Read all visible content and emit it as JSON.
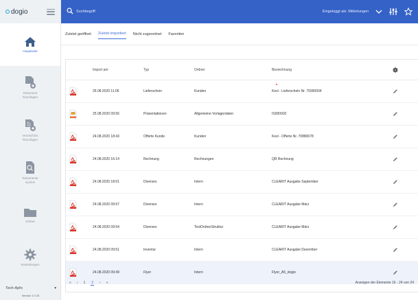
{
  "app": {
    "logo_text": "dogio"
  },
  "sidebar": {
    "items": [
      {
        "label": "Hauptseite",
        "icon": "home-icon",
        "active": true
      },
      {
        "label": "Dokument\nhinzufügen",
        "icon": "document-add-icon",
        "active": false
      },
      {
        "label": "Verzeichnis\nhinzufügen",
        "icon": "folder-add-icon",
        "active": false
      },
      {
        "label": "Dokumente\nsuchen",
        "icon": "document-search-icon",
        "active": false
      },
      {
        "label": "Ordner",
        "icon": "folder-icon",
        "active": false
      },
      {
        "label": "Einstellungen",
        "icon": "settings-gear-icon",
        "active": false
      }
    ],
    "user_select": "Tech-Apfo",
    "version": "Version 1.0.23"
  },
  "topbar": {
    "search_placeholder": "Suchbegriff",
    "user_name": "Eingeloggt als: Mitteilungen",
    "accent": "#3562c7"
  },
  "tabs": [
    {
      "label": "Zuletzt geöffnet",
      "active": false
    },
    {
      "label": "Zuletzt importiert",
      "active": true
    },
    {
      "label": "Nicht zugeordnet",
      "active": false
    },
    {
      "label": "Favoriten",
      "active": false
    }
  ],
  "table": {
    "headers": {
      "date": "Import am",
      "typ": "Typ",
      "ordner": "Ordner",
      "bezeichnung": "Bezeichnung"
    },
    "rows": [
      {
        "file_type": "pdf",
        "date": "26.08.2020 11:06",
        "typ": "Lieferschein",
        "ordner": "Kunden",
        "bezeichnung": "Kesl - Lieferschein Nr. 75000004"
      },
      {
        "file_type": "ppt",
        "date": "25.08.2020 09:56",
        "typ": "Präsentationen",
        "ordner": "Allgemeine Vorlagendatei",
        "bezeichnung": "IS000002"
      },
      {
        "file_type": "pdf",
        "date": "24.08.2020 18:43",
        "typ": "Offerte Kunde",
        "ordner": "Kunden",
        "bezeichnung": "Kesl - Offerte Nr. 70880078"
      },
      {
        "file_type": "pdf",
        "date": "24.08.2020 16:14",
        "typ": "Rechnung",
        "ordner": "Rechnungen",
        "bezeichnung": "QR Rechnung"
      },
      {
        "file_type": "pdf",
        "date": "24.08.2020 18:01",
        "typ": "Diverses",
        "ordner": "Intern",
        "bezeichnung": "CLEARIT Ausgabe September"
      },
      {
        "file_type": "pdf",
        "date": "24.08.2020 09:57",
        "typ": "Diverses",
        "ordner": "Intern",
        "bezeichnung": "CLEARIT Ausgabe März"
      },
      {
        "file_type": "pdf",
        "date": "24.08.2020 09:54",
        "typ": "Diverses",
        "ordner": "TestOrdnerStruktur",
        "bezeichnung": "CLEARIT Ausgabe März"
      },
      {
        "file_type": "pdf",
        "date": "24.08.2020 09:51",
        "typ": "Inventur",
        "ordner": "Intern",
        "bezeichnung": "CLEARIT Ausgabe Dezember"
      },
      {
        "file_type": "pdf",
        "date": "24.08.2020 09:49",
        "typ": "Flyer",
        "ordner": "Intern",
        "bezeichnung": "Flyer_A5_dogio"
      }
    ]
  },
  "pager": {
    "first": "«",
    "prev": "‹",
    "pages": [
      "1",
      "2"
    ],
    "current_page": "2",
    "next": "›",
    "last": "»",
    "info": "Anzeigen der Elemente 16 - 24 von 24"
  }
}
